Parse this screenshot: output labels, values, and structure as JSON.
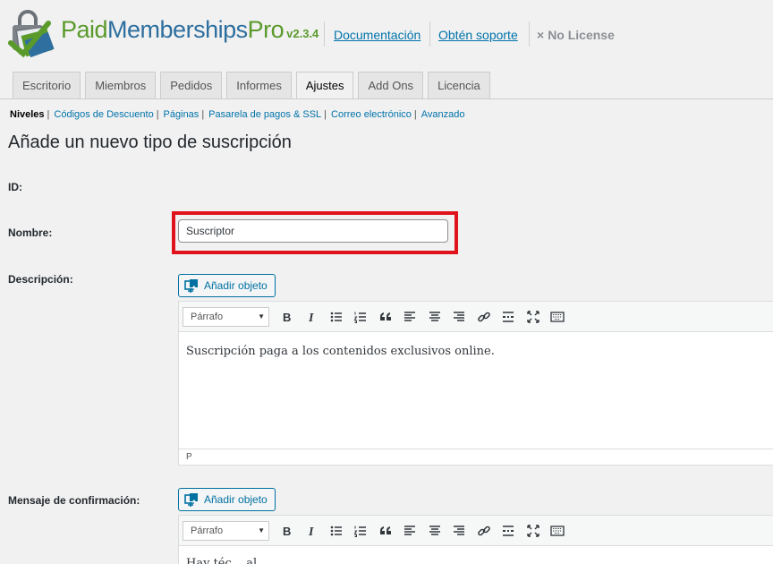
{
  "header": {
    "brand_part1": "Paid",
    "brand_part2": "Memberships",
    "brand_part3": "Pro",
    "version": "v2.3.4",
    "doc_link": "Documentación",
    "support_link": "Obtén soporte",
    "license_icon": "×",
    "license_text": "No License",
    "brand_color_green": "#5a9a2b",
    "brand_color_blue": "#2e6f9f"
  },
  "tabs": [
    {
      "label": "Escritorio",
      "active": false
    },
    {
      "label": "Miembros",
      "active": false
    },
    {
      "label": "Pedidos",
      "active": false
    },
    {
      "label": "Informes",
      "active": false
    },
    {
      "label": "Ajustes",
      "active": true
    },
    {
      "label": "Add Ons",
      "active": false
    },
    {
      "label": "Licencia",
      "active": false
    }
  ],
  "subnav": {
    "current": "Niveles",
    "links": [
      "Códigos de Descuento",
      "Páginas",
      "Pasarela de pagos & SSL",
      "Correo electrónico",
      "Avanzado"
    ]
  },
  "page": {
    "title": "Añade un nuevo tipo de suscripción"
  },
  "form": {
    "id_label": "ID:",
    "name_label": "Nombre:",
    "name_value": "Suscriptor",
    "highlight_color": "#e0131c",
    "description_label": "Descripción:",
    "confirmation_label": "Mensaje de confirmación:",
    "add_media_label": "Añadir objeto",
    "format_select": "Párrafo",
    "description_content": "Suscripción paga a los contenidos exclusivos online.",
    "status_path": "P",
    "confirmation_partial_content": "Hay téc... al..."
  },
  "toolbar_icons": [
    "bold-icon",
    "italic-icon",
    "bullet-list-icon",
    "numbered-list-icon",
    "blockquote-icon",
    "align-left-icon",
    "align-center-icon",
    "align-right-icon",
    "link-icon",
    "read-more-icon",
    "fullscreen-icon",
    "toolbar-toggle-icon"
  ],
  "toolbar_glyphs": {
    "bold": "B",
    "italic": "I"
  }
}
